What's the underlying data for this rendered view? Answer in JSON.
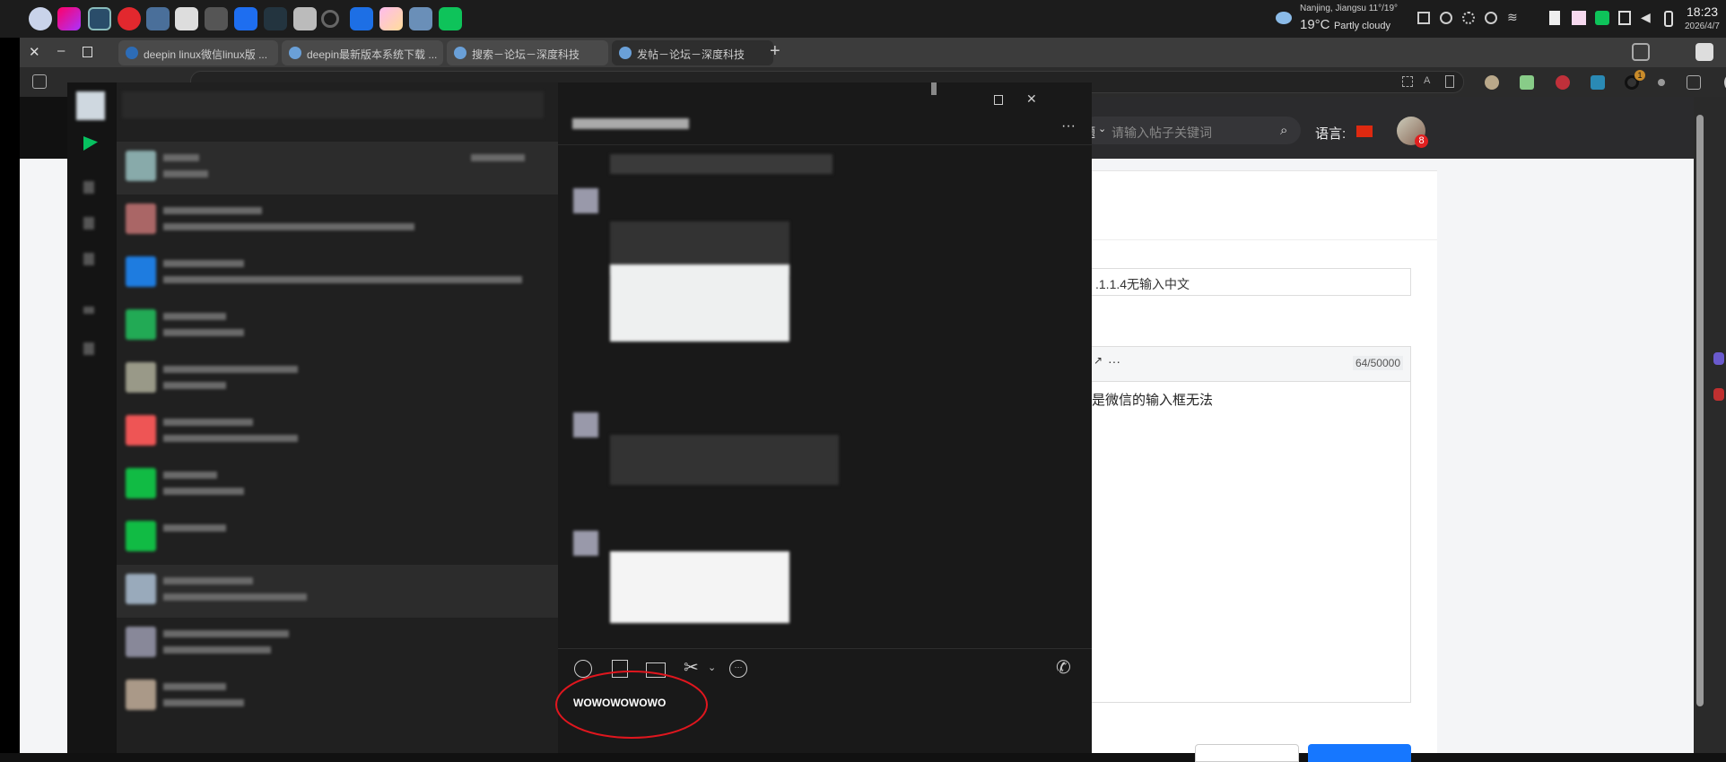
{
  "taskbar": {
    "weather": {
      "location": "Nanjing, Jiangsu",
      "range": "11°/19°",
      "temp": "19°C",
      "condition": "Partly cloudy"
    },
    "clock": {
      "time": "18:23",
      "date": "2026/4/7"
    }
  },
  "browser": {
    "tabs": [
      {
        "label": "deepin linux微信linux版 ..."
      },
      {
        "label": "deepin最新版本系统下载 ..."
      },
      {
        "label": "搜索－论坛－深度科技"
      },
      {
        "label": "发帖－论坛－深度科技",
        "active": true
      }
    ],
    "new_tab": "+",
    "extension_badge": "1"
  },
  "forum": {
    "search_scope": "题",
    "search_placeholder": "请输入帖子关键词",
    "language_label": "语言:",
    "notification_count": "8",
    "title_value": ".1.1.4无输入中文",
    "editor_more": "···",
    "char_counter": "64/50000",
    "body_text": "是微信的输入框无法"
  },
  "wechat": {
    "more": "···",
    "input_text": "WOWOWOWOWO",
    "annotation_color": "#e0161e"
  }
}
